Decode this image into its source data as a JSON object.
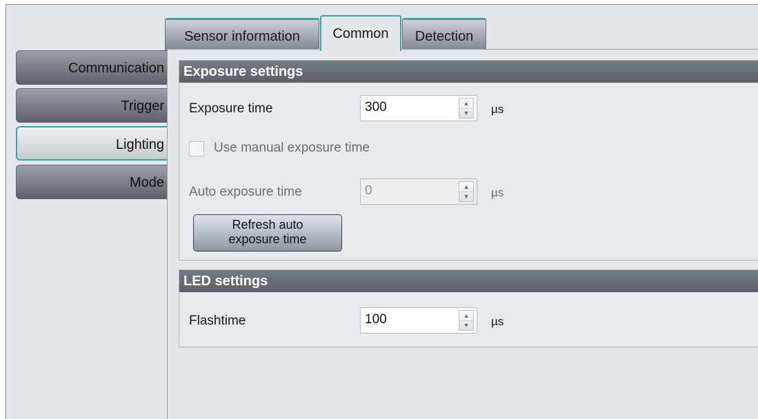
{
  "top_tabs": [
    {
      "label": "Sensor information",
      "active": false
    },
    {
      "label": "Common",
      "active": true
    },
    {
      "label": "Detection",
      "active": false
    }
  ],
  "side_tabs": [
    {
      "label": "Communication",
      "active": false
    },
    {
      "label": "Trigger",
      "active": false
    },
    {
      "label": "Lighting",
      "active": true
    },
    {
      "label": "Mode",
      "active": false
    }
  ],
  "exposure": {
    "header": "Exposure settings",
    "exposure_time_label": "Exposure time",
    "exposure_time_value": "300",
    "exposure_time_unit": "µs",
    "manual_checkbox_label": "Use manual exposure time",
    "manual_checked": false,
    "auto_label": "Auto exposure time",
    "auto_value": "0",
    "auto_unit": "µs",
    "refresh_line1": "Refresh auto",
    "refresh_line2": "exposure time"
  },
  "led": {
    "header": "LED settings",
    "flashtime_label": "Flashtime",
    "flashtime_value": "100",
    "flashtime_unit": "µs"
  },
  "colors": {
    "accent": "#3ea39a",
    "header_bg": "#666c73",
    "panel_bg": "#e3e6ea"
  }
}
